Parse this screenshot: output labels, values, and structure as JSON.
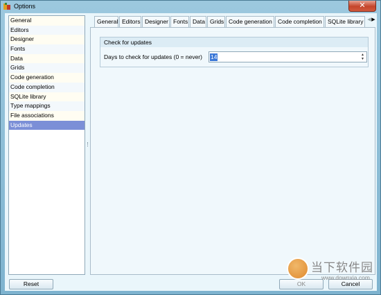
{
  "window": {
    "title": "Options",
    "close_glyph": "✕"
  },
  "sidebar": {
    "items": [
      {
        "label": "General"
      },
      {
        "label": "Editors"
      },
      {
        "label": "Designer"
      },
      {
        "label": "Fonts"
      },
      {
        "label": "Data"
      },
      {
        "label": "Grids"
      },
      {
        "label": "Code generation"
      },
      {
        "label": "Code completion"
      },
      {
        "label": "SQLite library"
      },
      {
        "label": "Type mappings"
      },
      {
        "label": "File associations"
      },
      {
        "label": "Updates"
      }
    ],
    "selected": "Updates"
  },
  "tabs": [
    {
      "label": "General"
    },
    {
      "label": "Editors"
    },
    {
      "label": "Designer"
    },
    {
      "label": "Fonts"
    },
    {
      "label": "Data"
    },
    {
      "label": "Grids"
    },
    {
      "label": "Code generation"
    },
    {
      "label": "Code completion"
    },
    {
      "label": "SQLite library"
    }
  ],
  "tab_scroll": {
    "left": "◀",
    "right": "▶"
  },
  "updates": {
    "group_title": "Check for updates",
    "days_label": "Days to check for updates (0 = never)",
    "days_value": "14",
    "spin_up": "▲",
    "spin_down": "▼"
  },
  "buttons": {
    "reset": "Reset",
    "ok": "OK",
    "cancel": "Cancel"
  },
  "watermark": {
    "text": "当下软件园",
    "url": "www.downxia.com"
  }
}
